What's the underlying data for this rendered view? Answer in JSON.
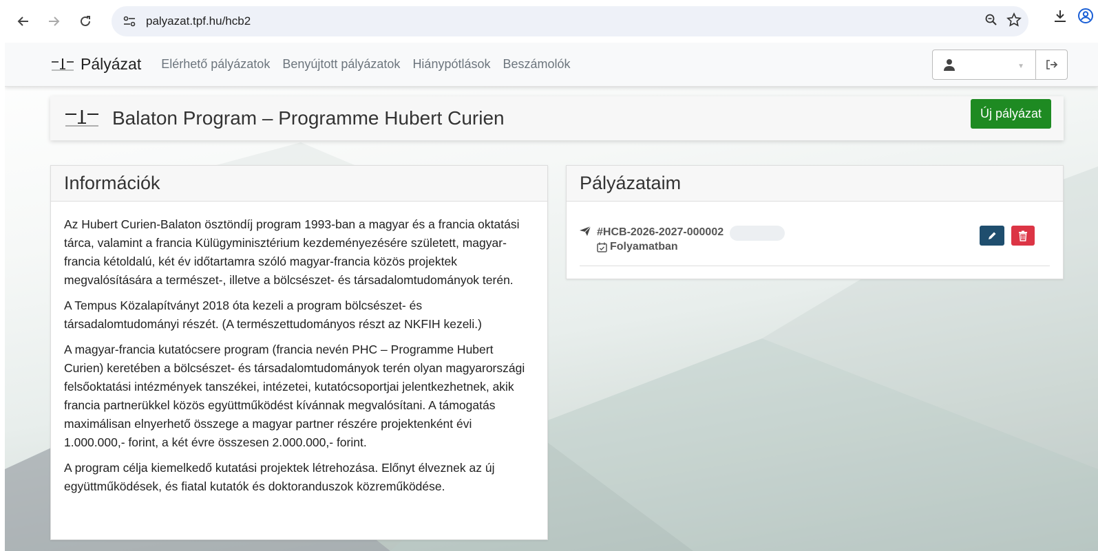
{
  "browser": {
    "url": "palyazat.tpf.hu/hcb2"
  },
  "navbar": {
    "brand": "Pályázat",
    "links": [
      {
        "label": "Elérhető pályázatok"
      },
      {
        "label": "Benyújtott pályázatok"
      },
      {
        "label": "Hiánypótlások"
      },
      {
        "label": "Beszámolók"
      }
    ]
  },
  "program": {
    "title": "Balaton Program – Programme Hubert Curien",
    "new_button": "Új pályázat"
  },
  "info": {
    "heading": "Információk",
    "paragraphs": [
      "Az Hubert Curien-Balaton ösztöndíj program 1993-ban a magyar és a francia oktatási tárca, valamint a francia Külügyminisztérium kezdeményezésére született, magyar-francia kétoldalú, két év időtartamra szóló magyar-francia közös projektek megvalósítására a természet-, illetve a bölcsészet- és társadalomtudományok terén.",
      "A Tempus Közalapítványt 2018 óta kezeli a program bölcsészet- és társadalomtudományi részét. (A természettudományos részt az NKFIH kezeli.)",
      "A magyar-francia kutatócsere program (francia nevén PHC – Programme Hubert Curien) keretében a bölcsészet- és társadalomtudományok terén olyan magyarországi felsőoktatási intézmények tanszékei, intézetei, kutatócsoportjai jelentkezhetnek, akik francia partnerükkel közös együttműködést kívánnak megvalósítani. A támogatás maximálisan elnyerhető összege a magyar partner részére projektenként évi 1.000.000,- forint, a két évre összesen 2.000.000,- forint.",
      "A program célja kiemelkedő kutatási projektek létrehozása. Előnyt élveznek az új együttműködések, és fiatal kutatók és doktoranduszok közreműködése."
    ]
  },
  "applications": {
    "heading": "Pályázataim",
    "items": [
      {
        "id": "#HCB-2026-2027-000002",
        "status": "Folyamatban"
      }
    ]
  },
  "colors": {
    "primary_green": "#1e8a22",
    "edit_blue": "#1f4e6e",
    "delete_red": "#dc3545"
  }
}
